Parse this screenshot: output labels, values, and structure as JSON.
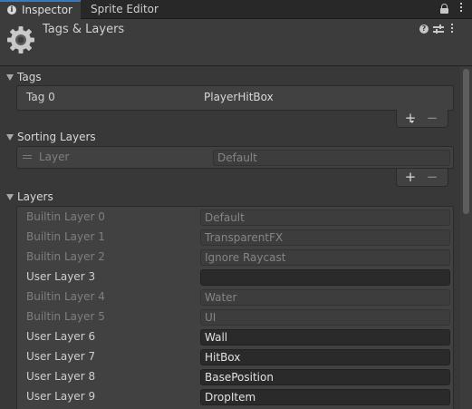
{
  "tabs": [
    {
      "label": "Inspector",
      "active": true
    },
    {
      "label": "Sprite Editor",
      "active": false
    }
  ],
  "header": {
    "title": "Tags & Layers",
    "help_glyph": "?"
  },
  "sections": {
    "tags": {
      "title": "Tags",
      "items": [
        {
          "name": "Tag 0",
          "value": "PlayerHitBox"
        }
      ],
      "add_label": "+",
      "remove_label": "−"
    },
    "sorting_layers": {
      "title": "Sorting Layers",
      "items": [
        {
          "name": "Layer",
          "value": "Default"
        }
      ],
      "add_label": "+",
      "remove_label": "−"
    },
    "layers": {
      "title": "Layers",
      "items": [
        {
          "name": "Builtin Layer 0",
          "value": "Default",
          "editable": false
        },
        {
          "name": "Builtin Layer 1",
          "value": "TransparentFX",
          "editable": false
        },
        {
          "name": "Builtin Layer 2",
          "value": "Ignore Raycast",
          "editable": false
        },
        {
          "name": "User Layer 3",
          "value": "",
          "editable": true
        },
        {
          "name": "Builtin Layer 4",
          "value": "Water",
          "editable": false
        },
        {
          "name": "Builtin Layer 5",
          "value": "UI",
          "editable": false
        },
        {
          "name": "User Layer 6",
          "value": "Wall",
          "editable": true
        },
        {
          "name": "User Layer 7",
          "value": "HitBox",
          "editable": true
        },
        {
          "name": "User Layer 8",
          "value": "BasePosition",
          "editable": true
        },
        {
          "name": "User Layer 9",
          "value": "DropItem",
          "editable": true
        }
      ]
    }
  },
  "colors": {
    "accent": "#3a79bb",
    "panel": "#383838",
    "field": "#2a2a2a"
  },
  "icons": {
    "inspector": "info-icon",
    "lock": "lock-icon",
    "menu": "kebab-menu-icon",
    "component": "gear-icon",
    "help": "help-icon",
    "presets": "presets-sliders-icon"
  }
}
